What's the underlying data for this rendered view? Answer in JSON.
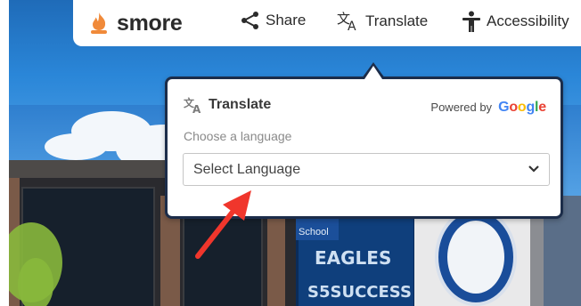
{
  "navbar": {
    "logo_text": "smore",
    "share_label": "Share",
    "translate_label": "Translate",
    "accessibility_label": "Accessibility"
  },
  "translate_popover": {
    "title": "Translate",
    "powered_by": "Powered by",
    "google_text": "Google",
    "choose_label": "Choose a language",
    "select_value": "Select Language"
  },
  "background_sign": {
    "school": "School",
    "line1": "EAGLES",
    "line2": "S5SUCCESS"
  },
  "colors": {
    "accent_blue": "#2a86d8",
    "popover_border": "#1c2d4a",
    "annotation_arrow": "#f0362c"
  }
}
